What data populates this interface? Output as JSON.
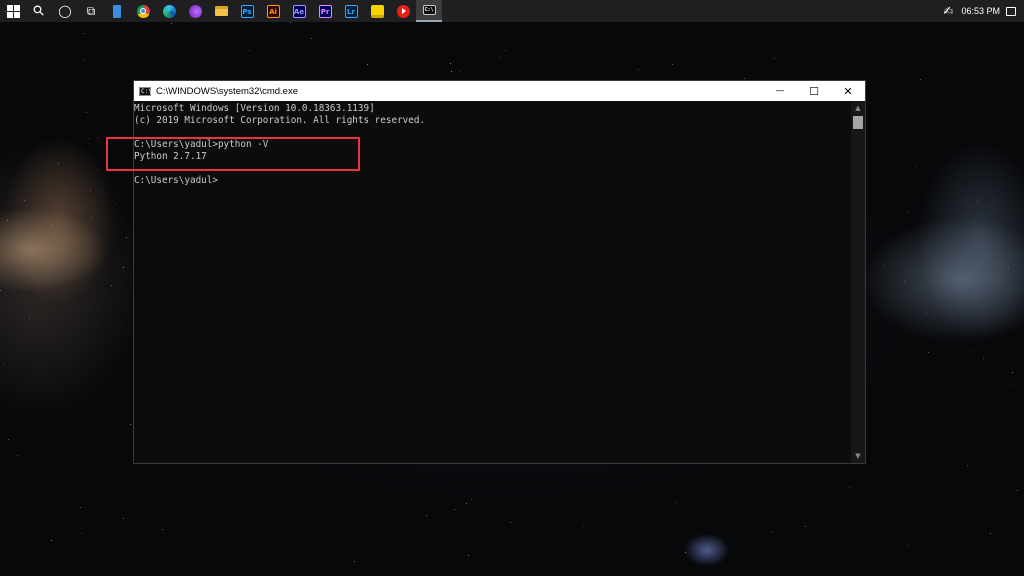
{
  "taskbar": {
    "icons": [
      {
        "name": "start-icon"
      },
      {
        "name": "search-icon",
        "glyph": "⚲"
      },
      {
        "name": "cortana-icon",
        "glyph": "◯"
      },
      {
        "name": "task-view-icon",
        "glyph": "⧉"
      },
      {
        "name": "phone-icon",
        "color": "#3b8de0"
      },
      {
        "name": "chrome-icon"
      },
      {
        "name": "edge-icon"
      },
      {
        "name": "tor-browser-icon"
      },
      {
        "name": "file-explorer-icon"
      },
      {
        "name": "photoshop-icon",
        "label": "Ps",
        "bg": "#001e36",
        "fg": "#31a8ff"
      },
      {
        "name": "illustrator-icon",
        "label": "Ai",
        "bg": "#330000",
        "fg": "#ff9a00"
      },
      {
        "name": "after-effects-icon",
        "label": "Ae",
        "bg": "#00005b",
        "fg": "#9999ff"
      },
      {
        "name": "premiere-icon",
        "label": "Pr",
        "bg": "#00005b",
        "fg": "#9999ff"
      },
      {
        "name": "lightroom-icon",
        "label": "Lr",
        "bg": "#001e36",
        "fg": "#31a8ff"
      },
      {
        "name": "sticky-notes-icon",
        "color": "#f7d200"
      },
      {
        "name": "youtube-icon",
        "color": "#e62117"
      },
      {
        "name": "cmd-icon",
        "active": true
      }
    ],
    "clock": "06:53 PM"
  },
  "window": {
    "title": "C:\\WINDOWS\\system32\\cmd.exe",
    "icon_label": "C:\\",
    "minimize_glyph": "—",
    "maximize_glyph": "☐",
    "close_glyph": "✕"
  },
  "console": {
    "lines": [
      "Microsoft Windows [Version 10.0.18363.1139]",
      "(c) 2019 Microsoft Corporation. All rights reserved.",
      "",
      "C:\\Users\\yadul>python -V",
      "Python 2.7.17",
      "",
      "C:\\Users\\yadul>"
    ]
  },
  "scrollbar": {
    "up_glyph": "▲",
    "down_glyph": "▼"
  },
  "colors": {
    "highlight": "#e8363f",
    "console_bg": "#0c0c0c",
    "console_text": "#cccccc",
    "taskbar_bg": "#1f1f21"
  }
}
